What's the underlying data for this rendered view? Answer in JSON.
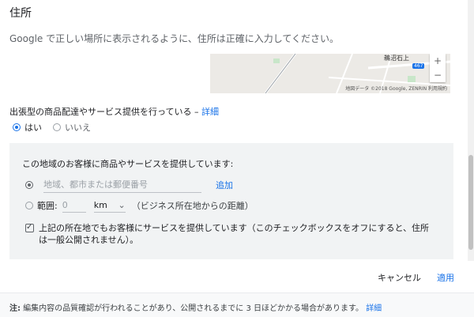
{
  "page": {
    "title": "住所",
    "description": "Google で正しい場所に表示されるように、住所は正確に入力してください。"
  },
  "map": {
    "place_label": "鵜沼石上",
    "badge": "467",
    "zoom_in": "+",
    "zoom_out": "−",
    "attribution": "地図データ ©2018 Google, ZENRIN  利用規約"
  },
  "delivery": {
    "question": "出張型の商品配達やサービス提供を行っている –",
    "details_link": "詳細",
    "yes_label": "はい",
    "no_label": "いいえ",
    "selected": "yes"
  },
  "service_area": {
    "title": "この地域のお客様に商品やサービスを提供しています:",
    "area_placeholder": "地域、都市または郵便番号",
    "add_label": "追加",
    "range_label": "範囲:",
    "range_value": "0",
    "unit": "km",
    "range_note": "（ビジネス所在地からの距離）",
    "checkbox_label": "上記の所在地でもお客様にサービスを提供しています（このチェックボックスをオフにすると、住所は一般公開されません）。",
    "checkbox_checked": true
  },
  "actions": {
    "cancel_label": "キャンセル",
    "apply_label": "適用"
  },
  "footer": {
    "note_prefix": "注:",
    "note": " 編集内容の品質確認が行われることがあり、公開されるまでに 3 日ほどかかる場合があります。",
    "details_link": "詳細"
  },
  "colors": {
    "accent": "#1a73e8",
    "panel_bg": "#f1f3f4"
  }
}
